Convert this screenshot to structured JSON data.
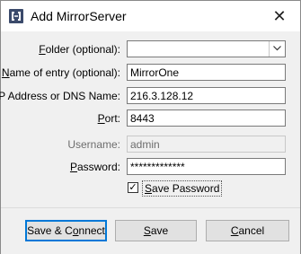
{
  "window": {
    "title": "Add MirrorServer",
    "close_glyph": "✕",
    "app_icon": "mirror-server-icon"
  },
  "form": {
    "folder": {
      "label": "Folder (optional):",
      "value": ""
    },
    "name": {
      "label": "Name of entry (optional):",
      "value": "MirrorOne"
    },
    "address": {
      "label": "IP Address or DNS Name:",
      "value": "216.3.128.12"
    },
    "port": {
      "label": "Port:",
      "value": "8443"
    },
    "username": {
      "label": "Username:",
      "value": "admin",
      "disabled": true
    },
    "password": {
      "label": "Password:",
      "value": "*************"
    },
    "save_password": {
      "label": "Save Password",
      "checked": true,
      "check_glyph": "✓"
    }
  },
  "buttons": {
    "save_connect": "Save & Connect",
    "save": "Save",
    "cancel": "Cancel"
  },
  "colors": {
    "accent": "#0078d7",
    "panel_bg": "#f0f0f0",
    "disabled_text": "#6d6d6d"
  }
}
